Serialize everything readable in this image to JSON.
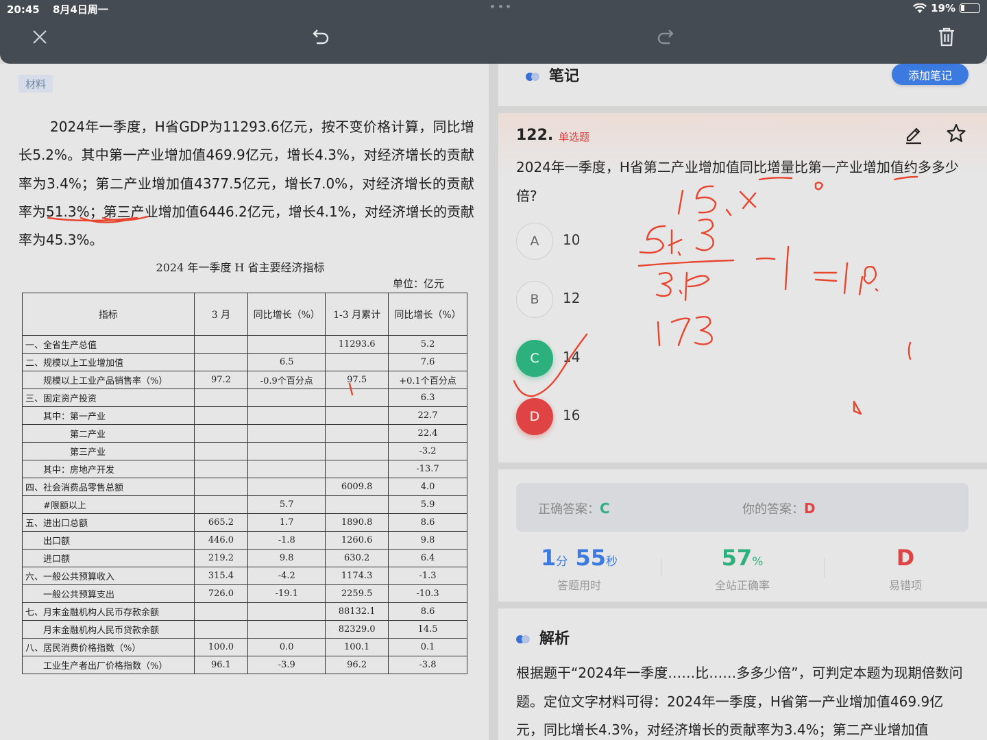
{
  "status_bar": {
    "time": "20:45",
    "date": "8月4日周一",
    "battery": "19%",
    "battery_level": 0.19
  },
  "toolbar": {
    "icons": [
      "close-icon",
      "undo-icon",
      "redo-icon",
      "trash-icon"
    ]
  },
  "material": {
    "tag": "材料",
    "paragraph": "2024年一季度，H省GDP为11293.6亿元，按不变价格计算，同比增长5.2%。其中第一产业增加值469.9亿元，增长4.3%，对经济增长的贡献率为3.4%；第二产业增加值4377.5亿元，增长7.0%，对经济增长的贡献率为51.3%；第三产业增加值6446.2亿元，增长4.1%，对经济增长的贡献率为45.3%。",
    "table_title": "2024 年一季度 H 省主要经济指标",
    "table_unit": "单位：亿元",
    "columns": [
      "指标",
      "3 月",
      "同比增长（%）",
      "1-3 月累计",
      "同比增长（%）"
    ],
    "rows": [
      [
        "一、全省生产总值",
        "",
        "",
        "11293.6",
        "5.2"
      ],
      [
        "二、规模以上工业增加值",
        "",
        "6.5",
        "",
        "7.6"
      ],
      [
        "　　规模以上工业产品销售率（%）",
        "97.2",
        "-0.9个百分点",
        "97.5",
        "+0.1个百分点"
      ],
      [
        "三、固定资产投资",
        "",
        "",
        "",
        "6.3"
      ],
      [
        "　　其中：第一产业",
        "",
        "",
        "",
        "22.7"
      ],
      [
        "　　　　　第二产业",
        "",
        "",
        "",
        "22.4"
      ],
      [
        "　　　　　第三产业",
        "",
        "",
        "",
        "-3.2"
      ],
      [
        "　　其中：房地产开发",
        "",
        "",
        "",
        "-13.7"
      ],
      [
        "四、社会消费品零售总额",
        "",
        "",
        "6009.8",
        "4.0"
      ],
      [
        "　　#限额以上",
        "",
        "5.7",
        "",
        "5.9"
      ],
      [
        "五、进出口总额",
        "665.2",
        "1.7",
        "1890.8",
        "8.6"
      ],
      [
        "　　出口额",
        "446.0",
        "-1.8",
        "1260.6",
        "9.8"
      ],
      [
        "　　进口额",
        "219.2",
        "9.8",
        "630.2",
        "6.4"
      ],
      [
        "六、一般公共预算收入",
        "315.4",
        "-4.2",
        "1174.3",
        "-1.3"
      ],
      [
        "　　一般公共预算支出",
        "726.0",
        "-19.1",
        "2259.5",
        "-10.3"
      ],
      [
        "七、月末金融机构人民币存款余额",
        "",
        "",
        "88132.1",
        "8.6"
      ],
      [
        "　　月末金融机构人民币贷款余额",
        "",
        "",
        "82329.0",
        "14.5"
      ],
      [
        "八、居民消费价格指数（%）",
        "100.0",
        "0.0",
        "100.1",
        "0.1"
      ],
      [
        "　　工业生产者出厂价格指数（%）",
        "96.1",
        "-3.9",
        "96.2",
        "-3.8"
      ]
    ]
  },
  "notes": {
    "title": "笔记",
    "add_button": "添加笔记"
  },
  "question": {
    "number": "122.",
    "type": "单选题",
    "text": "2024年一季度，H省第二产业增加值同比增量比第一产业增加值约多多少倍?",
    "options": [
      {
        "letter": "A",
        "value": "10",
        "state": "normal"
      },
      {
        "letter": "B",
        "value": "12",
        "state": "normal"
      },
      {
        "letter": "C",
        "value": "14",
        "state": "correct"
      },
      {
        "letter": "D",
        "value": "16",
        "state": "wrong"
      }
    ]
  },
  "result": {
    "correct_label": "正确答案：",
    "correct_value": "C",
    "yours_label": "你的答案：",
    "yours_value": "D",
    "time_min": "1",
    "time_min_unit": "分",
    "time_sec": "55",
    "time_sec_unit": "秒",
    "time_caption": "答题用时",
    "accuracy": "57",
    "accuracy_unit": "%",
    "accuracy_caption": "全站正确率",
    "common_wrong": "D",
    "common_wrong_caption": "易错项"
  },
  "analysis": {
    "title": "解析",
    "text": "根据题干“2024年一季度……比……多多少倍”，可判定本题为现期倍数问题。定位文字材料可得：2024年一季度，H省第一产业增加值469.9亿元，同比增长4.3%，对经济增长的贡献率为3.4%；第二产业增加值"
  },
  "colors": {
    "accent": "#3b7ae0",
    "correct": "#2bb07e",
    "wrong": "#e04343",
    "ink": "#e8452e",
    "toolbar": "#454b52"
  }
}
